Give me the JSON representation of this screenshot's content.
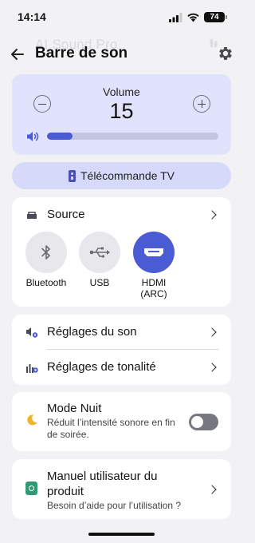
{
  "status_bar": {
    "time": "14:14",
    "battery": "74"
  },
  "header": {
    "ghost_title": "AI Sound Pro",
    "title": "Barre de son",
    "back_icon": "arrow-left-icon",
    "settings_icon": "gear-icon"
  },
  "volume": {
    "label": "Volume",
    "value": "15",
    "level_fraction": 0.15,
    "accent": "#4a5bd4"
  },
  "remote": {
    "label": "Télécommande TV"
  },
  "source": {
    "title": "Source",
    "options": [
      {
        "label": "Bluetooth",
        "icon": "bluetooth-icon",
        "active": false
      },
      {
        "label": "USB",
        "icon": "usb-icon",
        "active": false
      },
      {
        "label": "HDMI\n(ARC)",
        "icon": "hdmi-icon",
        "active": true
      }
    ]
  },
  "settings": {
    "items": [
      {
        "label": "Réglages du son",
        "icon": "sound-settings-icon"
      },
      {
        "label": "Réglages de tonalité",
        "icon": "equalizer-icon"
      }
    ]
  },
  "night_mode": {
    "title": "Mode Nuit",
    "description": "Réduit l’intensité sonore en fin de soirée.",
    "enabled": false
  },
  "manual": {
    "title": "Manuel utilisateur du produit",
    "description": "Besoin d’aide pour l’utilisation ?"
  }
}
